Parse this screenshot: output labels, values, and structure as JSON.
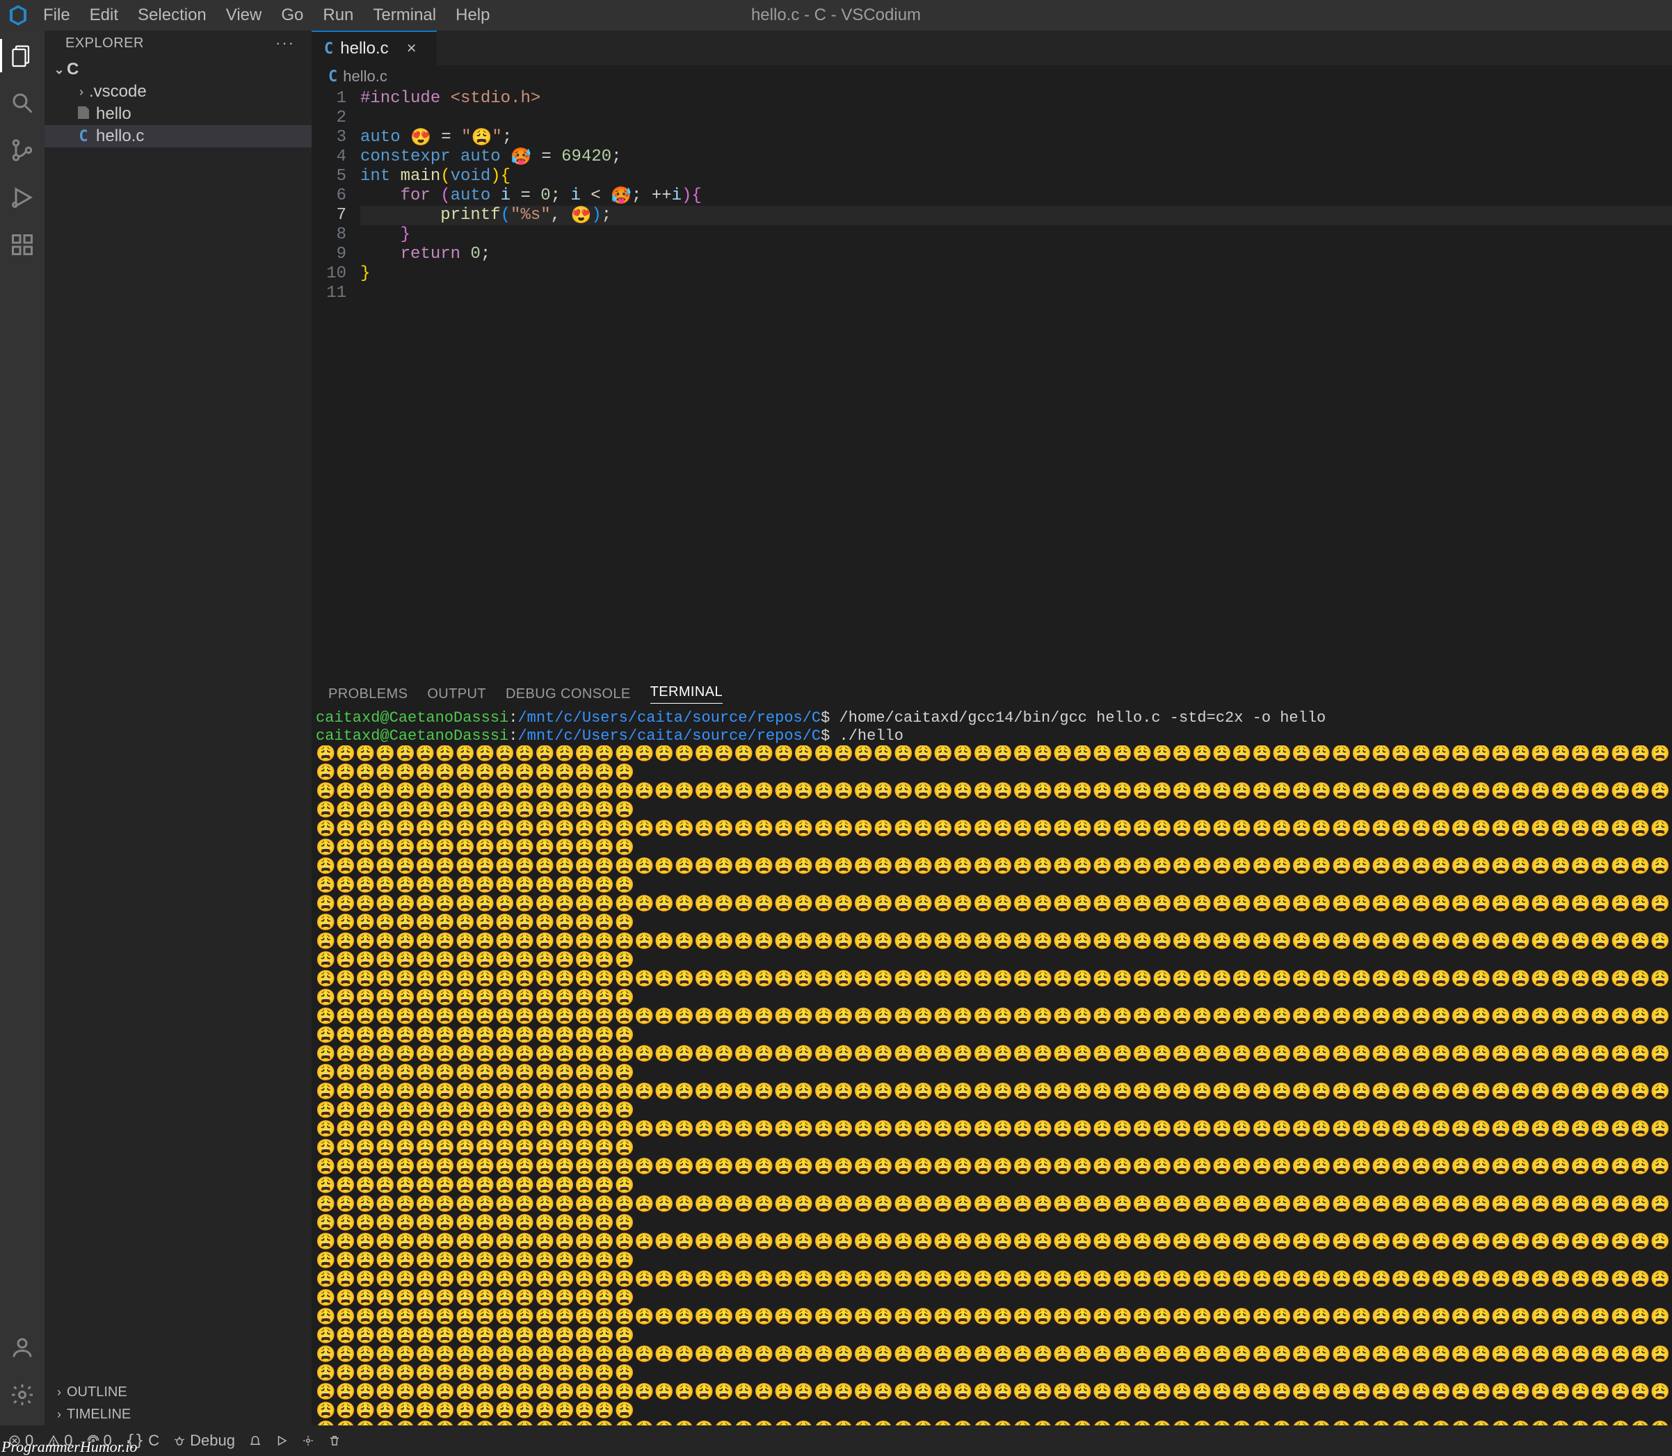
{
  "window": {
    "title": "hello.c - C - VSCodium"
  },
  "menu": [
    "File",
    "Edit",
    "Selection",
    "View",
    "Go",
    "Run",
    "Terminal",
    "Help"
  ],
  "sidebar": {
    "title": "EXPLORER",
    "root": "C",
    "items": [
      {
        "name": ".vscode",
        "type": "folder"
      },
      {
        "name": "hello",
        "type": "file"
      },
      {
        "name": "hello.c",
        "type": "c",
        "selected": true
      }
    ],
    "outline": "OUTLINE",
    "timeline": "TIMELINE"
  },
  "tab": {
    "label": "hello.c"
  },
  "breadcrumb": {
    "label": "hello.c"
  },
  "editor": {
    "current_line": 7,
    "lines": [
      {
        "n": 1,
        "segs": [
          {
            "t": "#include ",
            "c": "kw-directive"
          },
          {
            "t": "<stdio.h>",
            "c": "kw-include"
          }
        ]
      },
      {
        "n": 2,
        "segs": []
      },
      {
        "n": 3,
        "segs": [
          {
            "t": "auto ",
            "c": "kw-blue"
          },
          {
            "t": "😍",
            "c": "emoji"
          },
          {
            "t": " = ",
            "c": "punct"
          },
          {
            "t": "\"",
            "c": "kw-str"
          },
          {
            "t": "😩",
            "c": "emoji"
          },
          {
            "t": "\"",
            "c": "kw-str"
          },
          {
            "t": ";",
            "c": "punct"
          }
        ]
      },
      {
        "n": 4,
        "segs": [
          {
            "t": "constexpr ",
            "c": "kw-blue"
          },
          {
            "t": "auto ",
            "c": "kw-blue"
          },
          {
            "t": "🥵",
            "c": "emoji"
          },
          {
            "t": " = ",
            "c": "punct"
          },
          {
            "t": "69420",
            "c": "kw-num"
          },
          {
            "t": ";",
            "c": "punct"
          }
        ]
      },
      {
        "n": 5,
        "segs": [
          {
            "t": "int ",
            "c": "kw-blue"
          },
          {
            "t": "main",
            "c": "kw-func"
          },
          {
            "t": "(",
            "c": "paren-y"
          },
          {
            "t": "void",
            "c": "kw-blue"
          },
          {
            "t": ")",
            "c": "paren-y"
          },
          {
            "t": "{",
            "c": "paren-y"
          }
        ]
      },
      {
        "n": 6,
        "segs": [
          {
            "t": "    ",
            "c": "punct"
          },
          {
            "t": "for ",
            "c": "kw-purple"
          },
          {
            "t": "(",
            "c": "paren-p"
          },
          {
            "t": "auto ",
            "c": "kw-blue"
          },
          {
            "t": "i",
            "c": "kw-var"
          },
          {
            "t": " = ",
            "c": "punct"
          },
          {
            "t": "0",
            "c": "kw-num"
          },
          {
            "t": "; ",
            "c": "punct"
          },
          {
            "t": "i",
            "c": "kw-var"
          },
          {
            "t": " < ",
            "c": "punct"
          },
          {
            "t": "🥵",
            "c": "emoji"
          },
          {
            "t": "; ++",
            "c": "punct"
          },
          {
            "t": "i",
            "c": "kw-var"
          },
          {
            "t": ")",
            "c": "paren-p"
          },
          {
            "t": "{",
            "c": "paren-p"
          }
        ]
      },
      {
        "n": 7,
        "segs": [
          {
            "t": "        ",
            "c": "punct"
          },
          {
            "t": "printf",
            "c": "kw-func"
          },
          {
            "t": "(",
            "c": "paren-b"
          },
          {
            "t": "\"%s\"",
            "c": "kw-str"
          },
          {
            "t": ", ",
            "c": "punct"
          },
          {
            "t": "😍",
            "c": "emoji"
          },
          {
            "t": ")",
            "c": "paren-b"
          },
          {
            "t": ";",
            "c": "punct"
          }
        ]
      },
      {
        "n": 8,
        "segs": [
          {
            "t": "    ",
            "c": "punct"
          },
          {
            "t": "}",
            "c": "paren-p"
          }
        ]
      },
      {
        "n": 9,
        "segs": [
          {
            "t": "    ",
            "c": "punct"
          },
          {
            "t": "return ",
            "c": "kw-purple"
          },
          {
            "t": "0",
            "c": "kw-num"
          },
          {
            "t": ";",
            "c": "punct"
          }
        ]
      },
      {
        "n": 10,
        "segs": [
          {
            "t": "}",
            "c": "paren-y"
          }
        ]
      },
      {
        "n": 11,
        "segs": []
      }
    ]
  },
  "panel": {
    "tabs": [
      "PROBLEMS",
      "OUTPUT",
      "DEBUG CONSOLE",
      "TERMINAL"
    ],
    "active": "TERMINAL"
  },
  "terminal": {
    "prompt_user": "caitaxd@CaetanoDasssi",
    "prompt_colon": ":",
    "prompt_path": "/mnt/c/Users/caita/source/repos/C",
    "prompt_dollar": "$ ",
    "cmd1": "/home/caitaxd/gcc14/bin/gcc hello.c -std=c2x  -o hello",
    "cmd2": "./hello",
    "output_emoji": "😩",
    "output_rows": 36,
    "output_cols": 84
  },
  "status": {
    "errors": "0",
    "warnings": "0",
    "ports": "0",
    "lang": "C",
    "debug": "Debug"
  },
  "watermark": "ProgrammerHumor.io"
}
